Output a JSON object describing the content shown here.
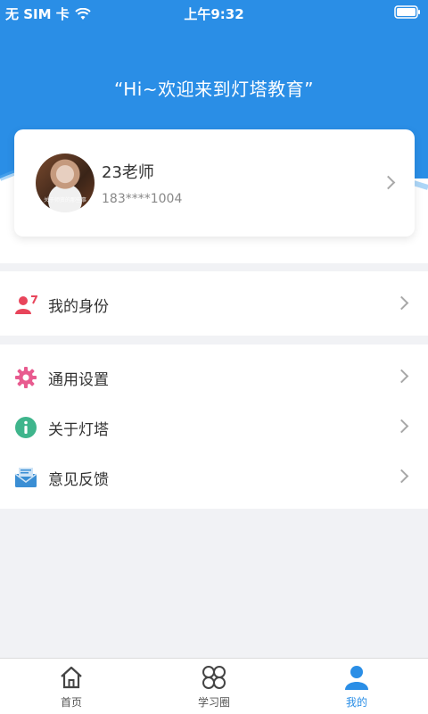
{
  "status_bar": {
    "carrier": "无 SIM 卡",
    "time": "上午9:32"
  },
  "header": {
    "welcome": "“Hi~欢迎来到灯塔教育”"
  },
  "profile": {
    "name": "23老师",
    "phone": "183****1004",
    "avatar_caption": "关于师资的那些事"
  },
  "menu": {
    "identity": {
      "label": "我的身份",
      "icon": "user-badge-icon"
    },
    "settings": {
      "label": "通用设置",
      "icon": "gear-icon"
    },
    "about": {
      "label": "关于灯塔",
      "icon": "info-icon"
    },
    "feedback": {
      "label": "意见反馈",
      "icon": "mail-icon"
    }
  },
  "tabbar": {
    "tabs": [
      {
        "label": "首页",
        "icon": "home-icon"
      },
      {
        "label": "学习圈",
        "icon": "circles-icon"
      },
      {
        "label": "我的",
        "icon": "person-icon",
        "active": true
      }
    ]
  },
  "colors": {
    "accent": "#2a8ee6",
    "identity_icon": "#e8455b",
    "settings_icon": "#e85b8f",
    "about_icon": "#3fb58c",
    "feedback_icon": "#3a8ed4"
  }
}
